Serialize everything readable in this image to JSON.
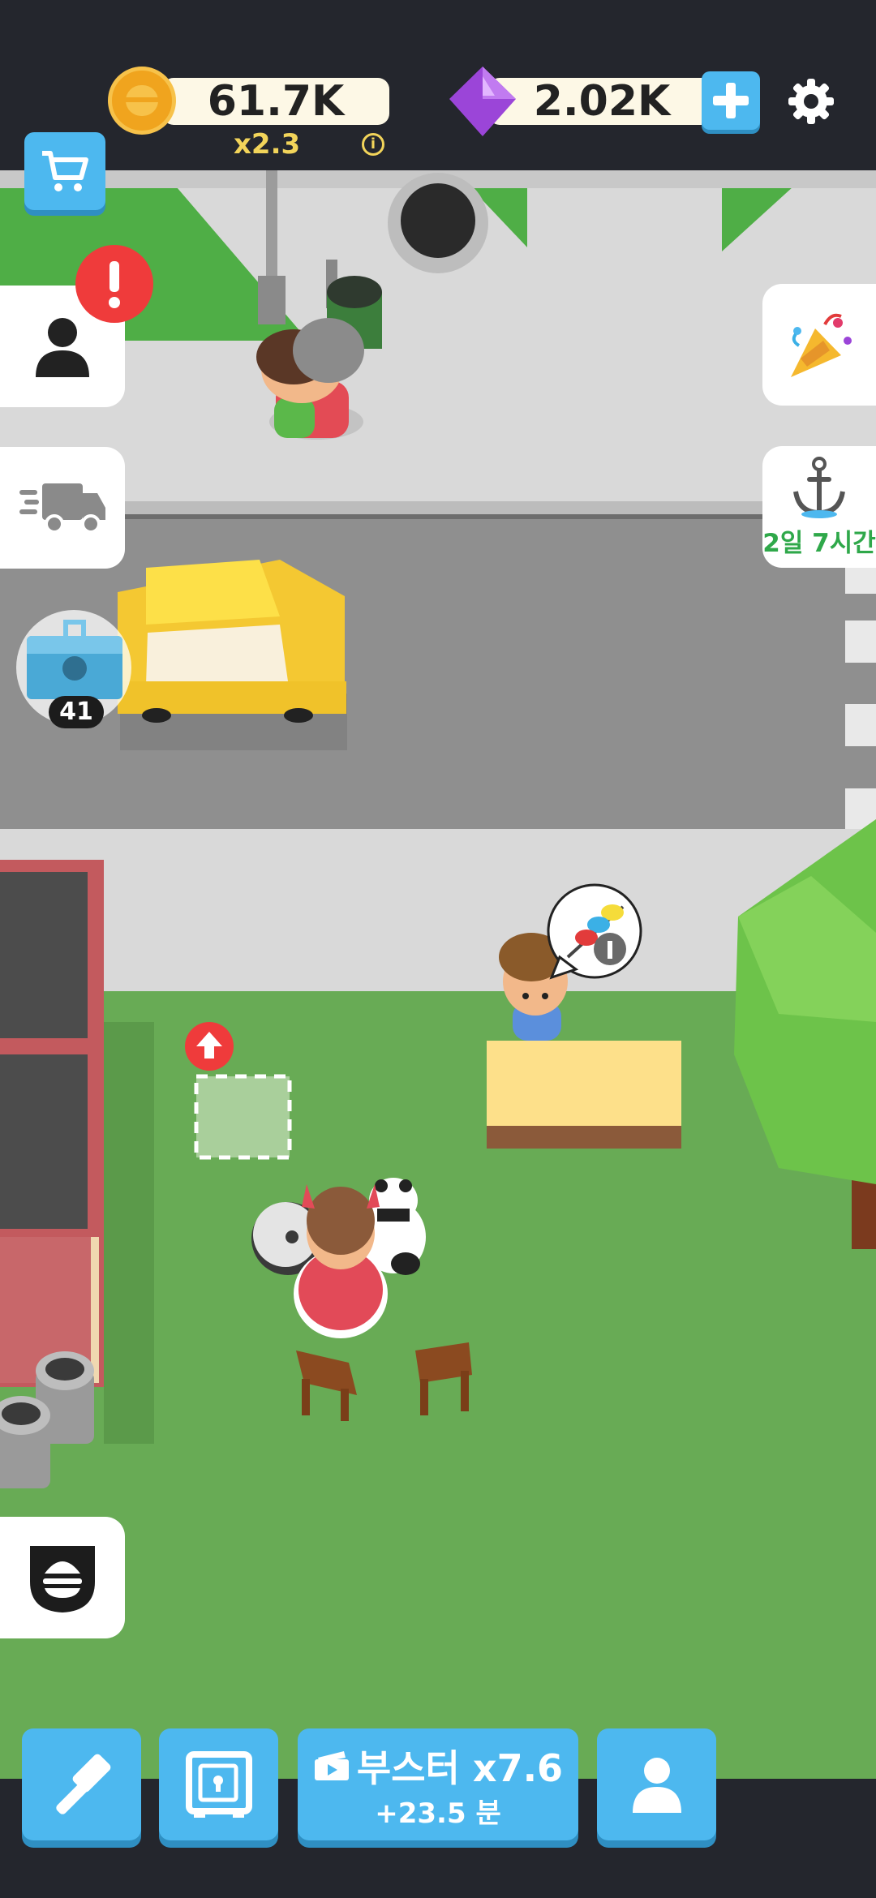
{
  "hud": {
    "coins": "61.7K",
    "multiplier": "x2.3",
    "info_icon": "info-icon",
    "gems": "2.02K",
    "add_gems_icon": "plus-icon",
    "settings_icon": "gear-icon"
  },
  "left_buttons": {
    "shop_icon": "cart-icon",
    "profile_icon": "person-icon",
    "alert_icon": "exclamation-icon",
    "delivery_icon": "truck-icon",
    "gift_box_count": "41",
    "menu_icon": "burger-badge-icon"
  },
  "right_buttons": {
    "event_icon": "party-popper-icon",
    "port_icon": "anchor-icon",
    "port_timer": "2일 7시간"
  },
  "bottom_bar": {
    "build_icon": "hammer-icon",
    "safe_icon": "safe-icon",
    "booster_label": "부스터 x7.6",
    "booster_sub": "+23.5 분",
    "booster_icon": "video-ad-icon",
    "staff_icon": "person-icon"
  },
  "colors": {
    "accent_blue": "#4db8ef",
    "alert_red": "#ef3b3b",
    "timer_green": "#2fa84a",
    "grass": "#68ab55",
    "road": "#8f8f8f"
  }
}
